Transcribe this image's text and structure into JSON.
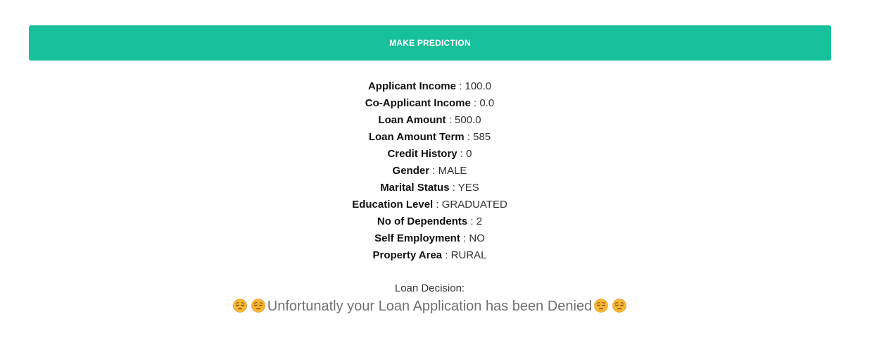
{
  "predict_button": {
    "label": "MAKE PREDICTION",
    "color": "#16c09a"
  },
  "results": [
    {
      "label": "Applicant Income",
      "value": "100.0"
    },
    {
      "label": "Co-Applicant Income",
      "value": "0.0"
    },
    {
      "label": "Loan Amount",
      "value": "500.0"
    },
    {
      "label": "Loan Amount Term",
      "value": "585"
    },
    {
      "label": "Credit History",
      "value": "0"
    },
    {
      "label": "Gender",
      "value": "MALE"
    },
    {
      "label": "Marital Status",
      "value": "YES"
    },
    {
      "label": "Education Level",
      "value": "GRADUATED"
    },
    {
      "label": "No of Dependents",
      "value": "2"
    },
    {
      "label": "Self Employment",
      "value": "NO"
    },
    {
      "label": "Property Area",
      "value": "RURAL"
    }
  ],
  "separator": ":",
  "decision": {
    "label": "Loan Decision:",
    "message": "Unfortunatly your Loan Application has been Denied",
    "icon": "pensive-face-emoji"
  }
}
